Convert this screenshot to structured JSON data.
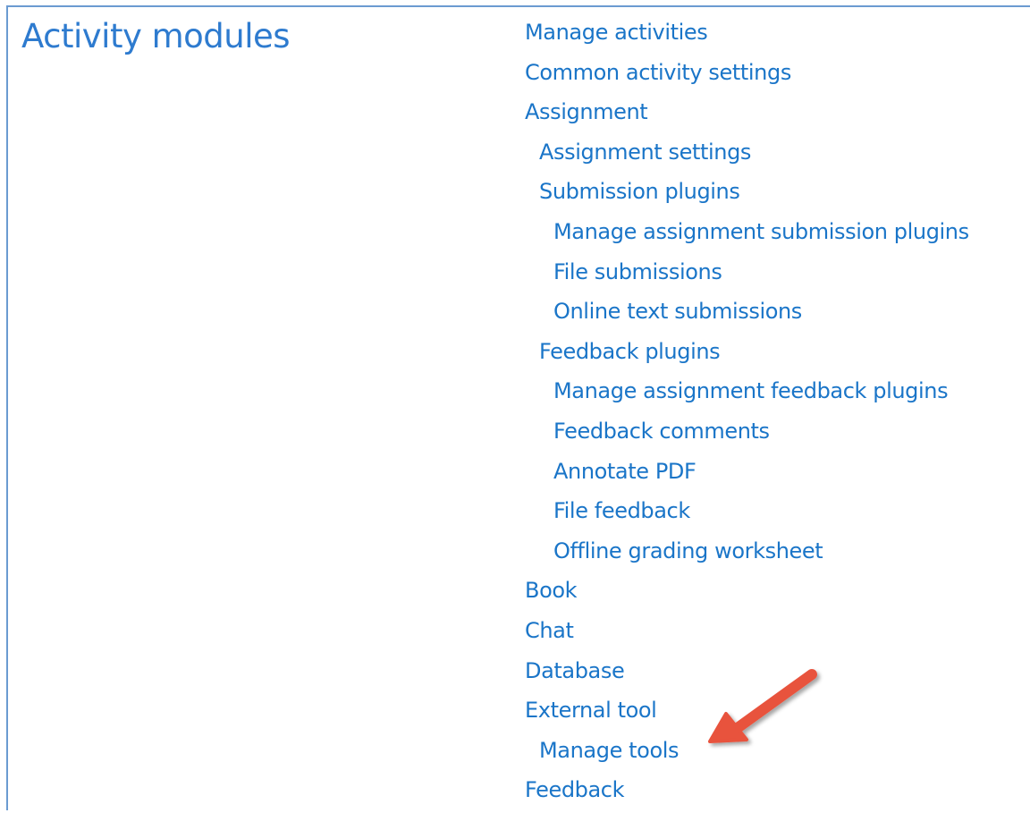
{
  "section": {
    "title": "Activity modules"
  },
  "nav": {
    "items": [
      {
        "name": "nav-manage-activities",
        "level": 1,
        "label": "Manage activities"
      },
      {
        "name": "nav-common-activity-settings",
        "level": 1,
        "label": "Common activity settings"
      },
      {
        "name": "nav-assignment",
        "level": 1,
        "label": "Assignment"
      },
      {
        "name": "nav-assignment-settings",
        "level": 2,
        "label": "Assignment settings"
      },
      {
        "name": "nav-submission-plugins",
        "level": 2,
        "label": "Submission plugins"
      },
      {
        "name": "nav-manage-assignment-submission-plugins",
        "level": 3,
        "label": "Manage assignment submission plugins"
      },
      {
        "name": "nav-file-submissions",
        "level": 3,
        "label": "File submissions"
      },
      {
        "name": "nav-online-text-submissions",
        "level": 3,
        "label": "Online text submissions"
      },
      {
        "name": "nav-feedback-plugins",
        "level": 2,
        "label": "Feedback plugins"
      },
      {
        "name": "nav-manage-assignment-feedback-plugins",
        "level": 3,
        "label": "Manage assignment feedback plugins"
      },
      {
        "name": "nav-feedback-comments",
        "level": 3,
        "label": "Feedback comments"
      },
      {
        "name": "nav-annotate-pdf",
        "level": 3,
        "label": "Annotate PDF"
      },
      {
        "name": "nav-file-feedback",
        "level": 3,
        "label": "File feedback"
      },
      {
        "name": "nav-offline-grading-worksheet",
        "level": 3,
        "label": "Offline grading worksheet"
      },
      {
        "name": "nav-book",
        "level": 1,
        "label": "Book"
      },
      {
        "name": "nav-chat",
        "level": 1,
        "label": "Chat"
      },
      {
        "name": "nav-database",
        "level": 1,
        "label": "Database"
      },
      {
        "name": "nav-external-tool",
        "level": 1,
        "label": "External tool"
      },
      {
        "name": "nav-manage-tools",
        "level": 2,
        "label": "Manage tools"
      },
      {
        "name": "nav-feedback",
        "level": 1,
        "label": "Feedback"
      }
    ]
  },
  "annotation": {
    "icon": "pointer-arrow-icon",
    "color": "#e8523d",
    "target": "Manage tools"
  },
  "colors": {
    "title": "#2e7bcf",
    "link": "#1a75c8",
    "frame": "#6b9bd1"
  }
}
